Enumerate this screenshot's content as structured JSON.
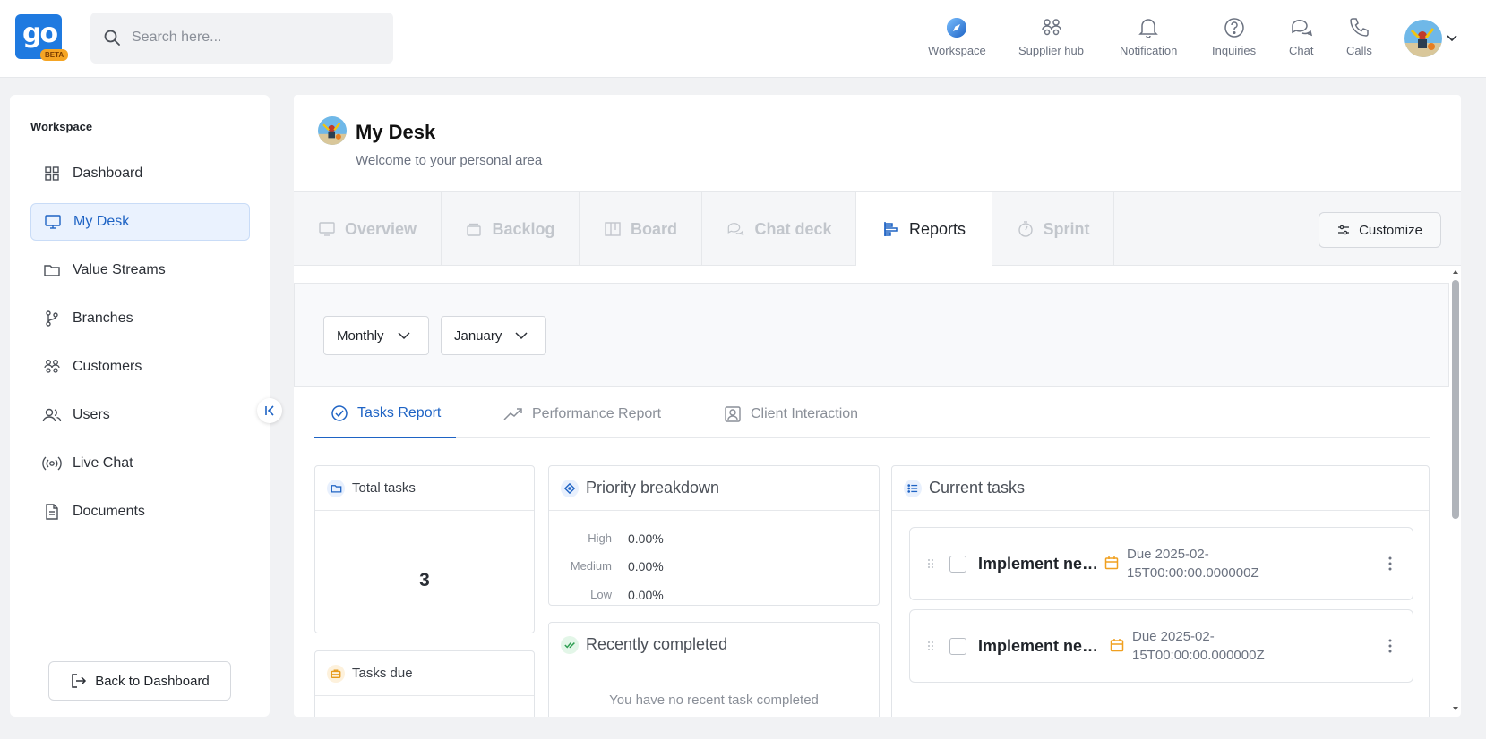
{
  "app": {
    "logo_text": "go",
    "beta_label": "BETA"
  },
  "search": {
    "placeholder": "Search here..."
  },
  "topnav": {
    "items": [
      {
        "label": "Workspace",
        "icon": "compass-icon"
      },
      {
        "label": "Supplier hub",
        "icon": "people-group-icon"
      },
      {
        "label": "Notification",
        "icon": "bell-icon"
      },
      {
        "label": "Inquiries",
        "icon": "question-circle-icon"
      },
      {
        "label": "Chat",
        "icon": "chat-bubbles-icon"
      },
      {
        "label": "Calls",
        "icon": "phone-icon"
      }
    ]
  },
  "sidebar": {
    "heading": "Workspace",
    "items": [
      {
        "label": "Dashboard",
        "icon": "grid-icon"
      },
      {
        "label": "My Desk",
        "icon": "monitor-icon",
        "active": true
      },
      {
        "label": "Value Streams",
        "icon": "folder-icon"
      },
      {
        "label": "Branches",
        "icon": "git-branch-icon"
      },
      {
        "label": "Customers",
        "icon": "people-group-icon"
      },
      {
        "label": "Users",
        "icon": "users-icon"
      },
      {
        "label": "Live Chat",
        "icon": "broadcast-icon"
      },
      {
        "label": "Documents",
        "icon": "document-icon"
      }
    ],
    "back_button": "Back to Dashboard"
  },
  "desk": {
    "title": "My Desk",
    "subtitle": "Welcome to your personal area"
  },
  "tabs": [
    {
      "label": "Overview",
      "icon": "monitor-icon"
    },
    {
      "label": "Backlog",
      "icon": "stack-icon"
    },
    {
      "label": "Board",
      "icon": "board-icon"
    },
    {
      "label": "Chat deck",
      "icon": "chat-bubbles-icon"
    },
    {
      "label": "Reports",
      "icon": "bar-chart-icon",
      "active": true
    },
    {
      "label": "Sprint",
      "icon": "timer-icon"
    }
  ],
  "customize_button": "Customize",
  "filters": {
    "period": "Monthly",
    "month": "January"
  },
  "report_tabs": [
    {
      "label": "Tasks Report",
      "icon": "check-circle-icon",
      "active": true
    },
    {
      "label": "Performance Report",
      "icon": "trend-up-icon"
    },
    {
      "label": "Client Interaction",
      "icon": "contact-icon"
    }
  ],
  "cards": {
    "total_tasks": {
      "title": "Total tasks",
      "value": "3"
    },
    "tasks_due": {
      "title": "Tasks due"
    },
    "priority": {
      "title": "Priority breakdown",
      "rows": [
        {
          "label": "High",
          "value": "0.00%"
        },
        {
          "label": "Medium",
          "value": "0.00%"
        },
        {
          "label": "Low",
          "value": "0.00%"
        }
      ]
    },
    "recently_completed": {
      "title": "Recently completed",
      "empty_text": "You have no recent task completed"
    },
    "current_tasks": {
      "title": "Current tasks",
      "items": [
        {
          "name": "Implement new...",
          "due_line1": "Due 2025-02-",
          "due_line2": "15T00:00:00.000000Z"
        },
        {
          "name": "Implement new...",
          "due_line1": "Due 2025-02-",
          "due_line2": "15T00:00:00.000000Z"
        }
      ]
    }
  },
  "colors": {
    "accent": "#1e63c4",
    "brand": "#1f7ae0",
    "beta": "#f5a524"
  }
}
